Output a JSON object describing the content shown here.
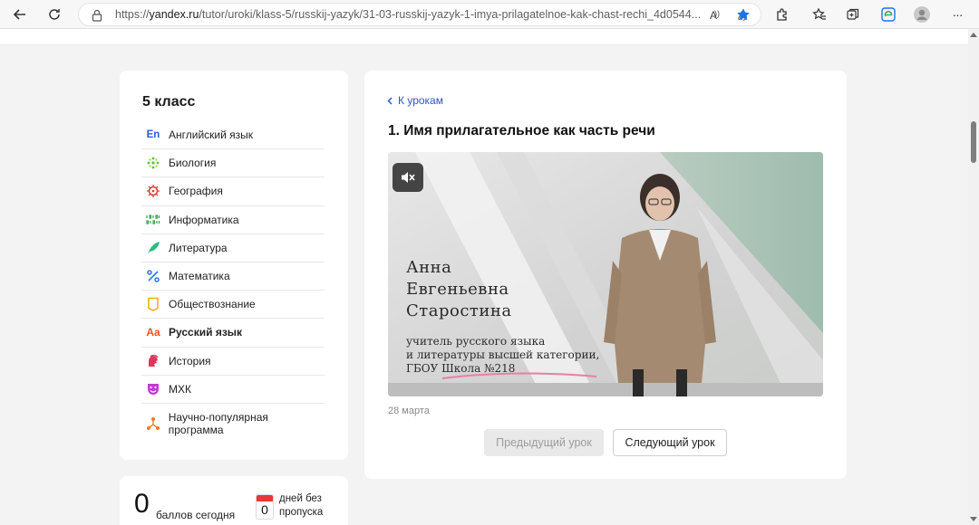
{
  "browser": {
    "url_prefix": "https://",
    "url_host": "yandex.ru",
    "url_path": "/tutor/uroki/klass-5/russkij-yazyk/31-03-russkij-yazyk-1-imya-prilagatelnoe-kak-chast-rechi_4d0544...",
    "read_aloud_glyph": "A",
    "translate_glyph": "あ",
    "more_glyph": "···"
  },
  "sidebar": {
    "title": "5 класс",
    "items": [
      {
        "label": "Английский язык",
        "icon": "En",
        "color": "#2a5bd7",
        "active": false
      },
      {
        "label": "Биология",
        "icon": "biology-icon",
        "color": "#5cc23a",
        "active": false
      },
      {
        "label": "География",
        "icon": "geography-icon",
        "color": "#e0392b",
        "active": false
      },
      {
        "label": "Информатика",
        "icon": "informatics-icon",
        "color": "#2fa44a",
        "active": false
      },
      {
        "label": "Литература",
        "icon": "literature-icon",
        "color": "#2dbb7d",
        "active": false
      },
      {
        "label": "Математика",
        "icon": "math-icon",
        "color": "#2a79e0",
        "active": false
      },
      {
        "label": "Обществознание",
        "icon": "social-icon",
        "color": "#f2b319",
        "active": false
      },
      {
        "label": "Русский язык",
        "icon": "Aa",
        "color": "#e8532b",
        "active": true
      },
      {
        "label": "История",
        "icon": "history-icon",
        "color": "#e4345b",
        "active": false
      },
      {
        "label": "МХК",
        "icon": "art-icon",
        "color": "#c23ad4",
        "active": false
      },
      {
        "label": "Научно-популярная программа",
        "icon": "science-icon",
        "color": "#f07a1e",
        "active": false
      }
    ]
  },
  "stats": {
    "points_value": "0",
    "points_label": "баллов сегодня",
    "streak_value": "0",
    "streak_label_line1": "дней без",
    "streak_label_line2": "пропуска"
  },
  "lesson": {
    "back_label": "К урокам",
    "title": "1. Имя прилагательное как часть речи",
    "video": {
      "name_line1": "Анна",
      "name_line2": "Евгеньевна",
      "name_line3": "Старостина",
      "sub_line1": "учитель русского языка",
      "sub_line2": "и литературы высшей категории,",
      "sub_line3": "ГБОУ Школа №218"
    },
    "date": "28 марта",
    "prev_label": "Предыдущий урок",
    "next_label": "Следующий урок"
  },
  "colors": {
    "link": "#2b57c7",
    "accent_star": "#1a73e8"
  }
}
